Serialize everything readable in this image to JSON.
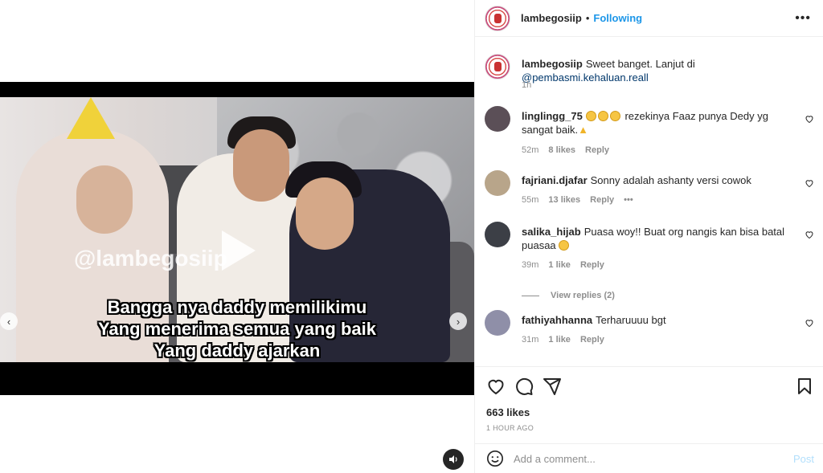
{
  "post": {
    "username": "lambegosiip",
    "follow_status": "Following",
    "separator": "•",
    "caption": "Sweet banget. Lanjut di ",
    "caption_mention": "@pembasmi.kehaluan.reall",
    "caption_time": "1h",
    "likes": "663 likes",
    "time_ago": "1 HOUR AGO"
  },
  "video": {
    "watermark": "@lambegosiip",
    "subtitle_lines": [
      "Bangga nya daddy memilikimu",
      "Yang menerima semua yang baik",
      "Yang daddy ajarkan"
    ],
    "prev_arrow": "‹",
    "next_arrow": "›"
  },
  "comments": [
    {
      "username": "linglingg_75",
      "text": " rezekinya Faaz punya Dedy yg sangat baik.",
      "time": "52m",
      "likes": "8 likes",
      "reply": "Reply"
    },
    {
      "username": "fajriani.djafar",
      "text": "Sonny adalah ashanty versi cowok",
      "time": "55m",
      "likes": "13 likes",
      "reply": "Reply",
      "more": "•••"
    },
    {
      "username": "salika_hijab",
      "text": "Puasa woy!! Buat org nangis kan bisa batal puasaa",
      "time": "39m",
      "likes": "1 like",
      "reply": "Reply",
      "view_replies": "View replies (2)"
    },
    {
      "username": "fathiyahhanna",
      "text": "Terharuuuu bgt",
      "time": "31m",
      "likes": "1 like",
      "reply": "Reply"
    }
  ],
  "composer": {
    "placeholder": "Add a comment...",
    "post_label": "Post"
  },
  "header": {
    "more": "•••"
  },
  "colors": {
    "accent": "#1c96e8",
    "mention": "#00376b",
    "muted": "#8e8e8e",
    "post_disabled": "#b2dffc"
  },
  "icons": [
    "heart-icon",
    "comment-icon",
    "share-icon",
    "bookmark-icon",
    "emoji-icon",
    "play-icon",
    "mute-icon",
    "more-icon"
  ]
}
